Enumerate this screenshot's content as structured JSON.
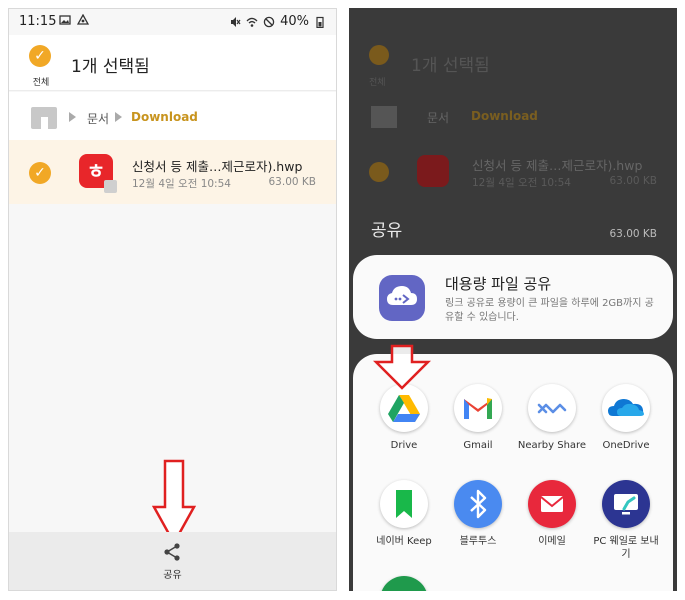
{
  "left": {
    "status": {
      "time": "11:15",
      "battery": "40%"
    },
    "selection": {
      "title": "1개 선택됨",
      "all_label": "전체"
    },
    "breadcrumb": {
      "folder": "문서",
      "current": "Download"
    },
    "file": {
      "name": "신청서 등 제출…제근로자).hwp",
      "date": "12월 4일 오전 10:54",
      "size": "63.00 KB",
      "icon_glyph": "ㅎ"
    },
    "bottom": {
      "share_label": "공유"
    }
  },
  "right": {
    "background": {
      "title": "1개 선택됨",
      "all_label": "전체",
      "folder": "문서",
      "current": "Download",
      "file_name": "신청서 등 제출…제근로자).hwp",
      "file_date": "12월 4일 오전 10:54",
      "file_size": "63.00 KB"
    },
    "sheet": {
      "title": "공유",
      "size": "63.00 KB",
      "large_share": {
        "title": "대용량 파일 공유",
        "desc": "링크 공유로 용량이 큰 파일을 하루에 2GB까지 공유할 수 있습니다."
      },
      "apps": [
        {
          "label": "Drive",
          "icon": "google-drive-icon"
        },
        {
          "label": "Gmail",
          "icon": "gmail-icon"
        },
        {
          "label": "Nearby Share",
          "icon": "nearby-share-icon"
        },
        {
          "label": "OneDrive",
          "icon": "onedrive-icon"
        },
        {
          "label": "네이버 Keep",
          "icon": "naver-keep-icon"
        },
        {
          "label": "블루투스",
          "icon": "bluetooth-icon"
        },
        {
          "label": "이메일",
          "icon": "email-icon"
        },
        {
          "label": "PC 웨일로 보내기",
          "icon": "whale-pc-icon"
        }
      ]
    }
  },
  "colors": {
    "accent": "#f1a826",
    "breadcrumb_current": "#c8941e",
    "selected_row": "#fdf4e6",
    "annotation_arrow": "#e02020"
  }
}
